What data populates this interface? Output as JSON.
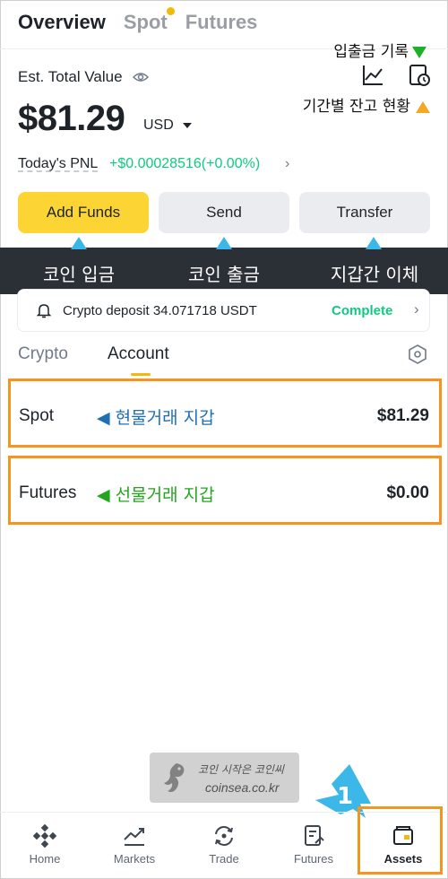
{
  "top_tabs": [
    "Overview",
    "Spot",
    "Futures"
  ],
  "annotations": {
    "history": "입출금 기록",
    "balance_history": "기간별 잔고 현황",
    "deposit": "코인 입금",
    "send": "코인 출금",
    "transfer": "지갑간 이체",
    "spot_wallet": "◀ 현물거래 지갑",
    "futures_wallet": "◀ 선물거래 지갑"
  },
  "balance": {
    "label": "Est. Total Value",
    "amount": "$81.29",
    "currency": "USD",
    "pnl_label": "Today's PNL",
    "pnl_value": "+$0.00028516(+0.00%)"
  },
  "actions": {
    "add_funds": "Add Funds",
    "send": "Send",
    "transfer": "Transfer"
  },
  "notice": {
    "text": "Crypto deposit 34.071718 USDT",
    "status": "Complete"
  },
  "sub_tabs": [
    "Crypto",
    "Account"
  ],
  "accounts": [
    {
      "name": "Spot",
      "value": "$81.29"
    },
    {
      "name": "Futures",
      "value": "$0.00"
    }
  ],
  "watermark": {
    "line1": "코인 시작은 코인씨",
    "line2": "coinsea.co.kr"
  },
  "callout_number": "1",
  "nav": [
    "Home",
    "Markets",
    "Trade",
    "Futures",
    "Assets"
  ],
  "colors": {
    "brand_yellow": "#fcd535",
    "positive_green": "#0ecb81",
    "highlight_orange": "#f7941d",
    "callout_blue": "#3bb7e8"
  }
}
